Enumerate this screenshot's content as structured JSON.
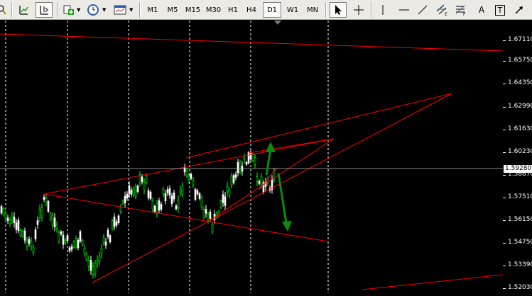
{
  "toolbar": {
    "timeframes": [
      "M1",
      "M5",
      "M15",
      "M30",
      "H1",
      "H4",
      "D1",
      "W1",
      "MN"
    ],
    "active_timeframe": "D1",
    "text_tool": "A",
    "text_label_tool": "T"
  },
  "price_scale": {
    "labels": [
      "1.67110",
      "1.65750",
      "1.64350",
      "1.62990",
      "1.61630",
      "1.60230",
      "1.58870",
      "1.57510",
      "1.56150",
      "1.54750",
      "1.53390",
      "1.52030"
    ],
    "current_price": "1.59280"
  },
  "colors": {
    "bull_candle": "#00ff00",
    "bear_candle": "#ffffff",
    "trendline": "#ff0000",
    "arrow": "#0b8a0b",
    "grid": "#ffffff",
    "background": "#000000"
  }
}
